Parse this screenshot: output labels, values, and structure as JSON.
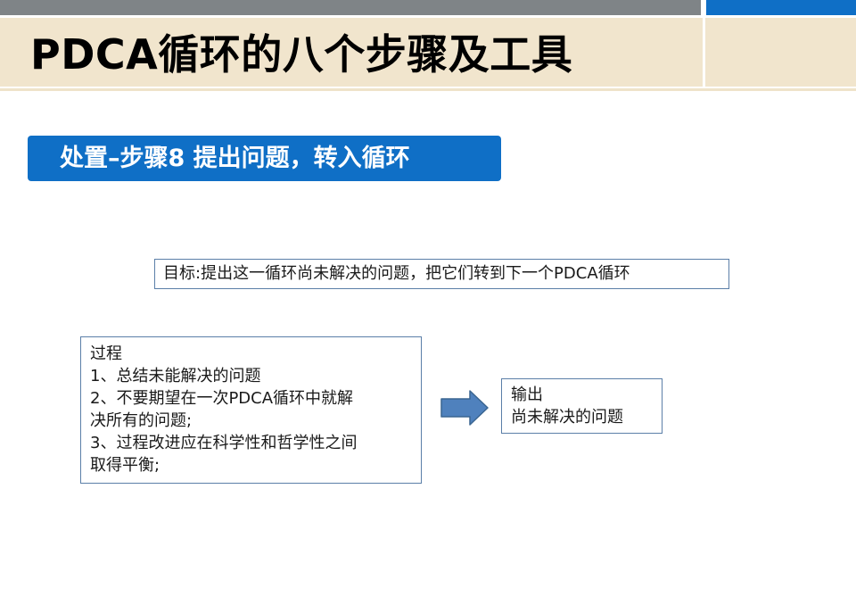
{
  "header": {
    "title": "PDCA循环的八个步骤及工具"
  },
  "step": {
    "banner": "处置–步骤8 提出问题，转入循环"
  },
  "goal": {
    "text": "目标:提出这一循环尚未解决的问题，把它们转到下一个PDCA循环"
  },
  "process": {
    "lines": [
      "过程",
      "1、总结未能解决的问题",
      "2、不要期望在一次PDCA循环中就解",
      "决所有的问题;",
      "3、过程改进应在科学性和哲学性之间",
      "取得平衡;"
    ]
  },
  "output": {
    "lines": [
      "输出",
      "尚未解决的问题"
    ]
  },
  "colors": {
    "accent_blue": "#0f6fc6",
    "header_band": "#f1e5cd",
    "topbar_gray": "#7f8487",
    "arrow_fill": "#4f81bd"
  },
  "icons": {
    "arrow": "right-arrow-icon"
  }
}
